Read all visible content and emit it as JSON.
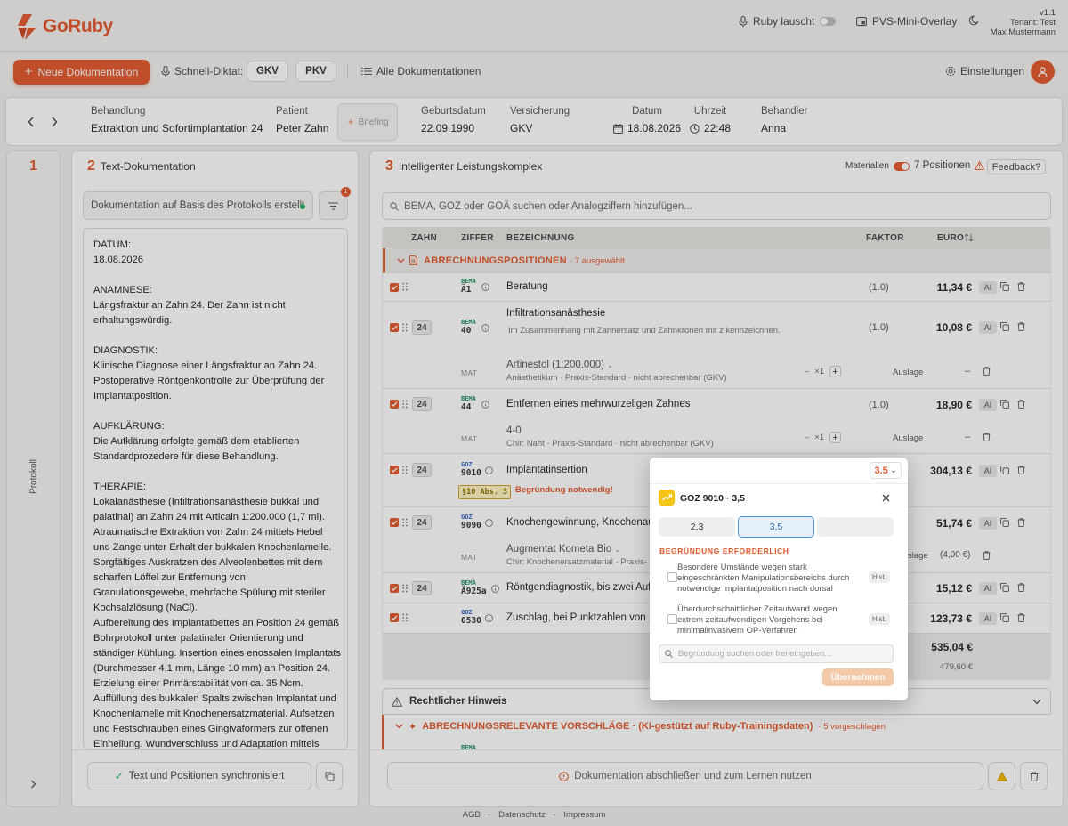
{
  "header": {
    "logo_text": "GoRuby",
    "listening_label": "Ruby lauscht",
    "overlay_label": "PVS-Mini-Overlay",
    "version": "v1.1",
    "tenant": "Tenant: Test",
    "user_name": "Max Mustermann"
  },
  "toolbar": {
    "new_doc_label": "Neue Dokumentation",
    "quick_dictation_label": "Schnell-Diktat:",
    "gkv_label": "GKV",
    "pkv_label": "PKV",
    "all_docs_label": "Alle Dokumentationen",
    "settings_label": "Einstellungen"
  },
  "patient_bar": {
    "treatment_label": "Behandlung",
    "treatment_value": "Extraktion und Sofortimplantation 24",
    "patient_label": "Patient",
    "patient_value": "Peter Zahn",
    "briefing_label": "Briefing",
    "dob_label": "Geburtsdatum",
    "dob_value": "22.09.1990",
    "insurance_label": "Versicherung",
    "insurance_value": "GKV",
    "date_label": "Datum",
    "date_value": "18.08.2026",
    "time_label": "Uhrzeit",
    "time_value": "22:48",
    "practitioner_label": "Behandler",
    "practitioner_value": "Anna"
  },
  "panel1": {
    "number": "1",
    "side_label": "Protokoll"
  },
  "panel2": {
    "number": "2",
    "title": "Text-Dokumentation",
    "template_select": "Dokumentation auf Basis des Protokolls erstellt",
    "filter_badge": "1",
    "lines": [
      "DATUM:",
      "18.08.2026",
      "",
      "ANAMNESE:",
      "Längsfraktur an Zahn 24. Der Zahn ist nicht",
      "erhaltungswürdig.",
      "",
      "DIAGNOSTIK:",
      "Klinische Diagnose einer Längsfraktur an Zahn 24.",
      "Postoperative Röntgenkontrolle zur Überprüfung der",
      "Implantatposition.",
      "",
      "AUFKLÄRUNG:",
      "Die Aufklärung erfolgte gemäß dem etablierten",
      "Standardprozedere für diese Behandlung.",
      "",
      "THERAPIE:",
      "Lokalanästhesie (Infiltrationsanästhesie bukkal und",
      "palatinal) an Zahn 24 mit Articain 1:200.000 (1,7 ml).",
      "Atraumatische Extraktion von Zahn 24 mittels Hebel",
      "und Zange unter Erhalt der bukkalen Knochenlamelle.",
      "Sorgfältiges Auskratzen des Alveolenbettes mit dem",
      "scharfen Löffel zur Entfernung von",
      "Granulationsgewebe, mehrfache Spülung mit steriler",
      "Kochsalzlösung (NaCl).",
      "Aufbereitung des Implantatbettes an Position 24 gemäß",
      "Bohrprotokoll unter palatinaler Orientierung und",
      "ständiger Kühlung. Insertion eines enossalen Implantats",
      "(Durchmesser 4,1 mm, Länge 10 mm) an Position 24.",
      "Erzielung einer Primärstabilität von ca. 35 Ncm.",
      "Auffüllung des bukkalen Spalts zwischen Implantat und",
      "Knochenlamelle mit Knochenersatzmaterial. Aufsetzen",
      "und Festschrauben eines Gingivaformers zur offenen",
      "Einheilung. Wundverschluss und Adaptation mittels"
    ],
    "sync_label": "Text und Positionen synchronisiert"
  },
  "panel3": {
    "number": "3",
    "title": "Intelligenter Leistungskomplex",
    "materials_label": "Materialien",
    "positions_count": "7 Positionen",
    "feedback_label": "Feedback?",
    "search_placeholder": "BEMA, GOZ oder GOÄ suchen oder Analogziffern hinzufügen...",
    "columns": {
      "tooth": "ZAHN",
      "code": "ZIFFER",
      "desc": "BEZEICHNUNG",
      "factor": "FAKTOR",
      "euro": "EURO"
    },
    "group_title": "ABRECHNUNGSPOSITIONEN",
    "group_count": "· 7 ausgewählt",
    "ai_label": "AI",
    "rows": [
      {
        "tooth": "",
        "sys": "BEMA",
        "code": "Ä1",
        "desc": "Beratung",
        "sub": "",
        "factor": "(1.0)",
        "euro": "11,34 €"
      },
      {
        "tooth": "24",
        "sys": "BEMA",
        "code": "40",
        "desc": "Infiltrationsanästhesie",
        "sub": "Im Zusammenhang mit Zahnersatz und Zahnkronen mit z kennzeichnen.",
        "factor": "(1.0)",
        "euro": "10,08 €"
      },
      {
        "tooth": "24",
        "sys": "BEMA",
        "code": "44",
        "desc": "Entfernen eines mehrwurzeligen Zahnes",
        "sub": "",
        "factor": "(1.0)",
        "euro": "18,90 €"
      },
      {
        "tooth": "24",
        "sys": "GOZ",
        "code": "9010",
        "desc": "Implantatinsertion",
        "sub": "",
        "factor": "",
        "euro": "304,13 €"
      },
      {
        "tooth": "24",
        "sys": "GOZ",
        "code": "9090",
        "desc": "Knochengewinnung, Knochenau",
        "sub": "",
        "factor": "",
        "euro": "51,74 €"
      },
      {
        "tooth": "24",
        "sys": "BEMA",
        "code": "Ä925a",
        "desc": "Röntgendiagnostik, bis zwei Auf",
        "sub": "",
        "factor": "",
        "euro": "15,12 €"
      },
      {
        "tooth": "",
        "sys": "GOZ",
        "code": "0530",
        "desc": "Zuschlag, bei Punktzahlen von 1",
        "sub": "",
        "factor": "",
        "euro": "123,73 €"
      }
    ],
    "materials": [
      {
        "tag": "MAT",
        "name": "Artinestol (1:200.000)",
        "sub": "Anästhetikum · Praxis-Standard · nicht abrechenbar (GKV)",
        "qty": "×1",
        "billing": "Auslage",
        "amount": "–"
      },
      {
        "tag": "MAT",
        "name": "4-0",
        "sub": "Chir: Naht · Praxis-Standard · nicht abrechenbar (GKV)",
        "qty": "×1",
        "billing": "Auslage",
        "amount": "–"
      },
      {
        "tag": "MAT",
        "name": "Augmentat Kometa Bio",
        "sub": "Chir: Knochenersatzmaterial · Praxis-",
        "qty": "",
        "billing": "slage",
        "amount": "(4,00 €)"
      }
    ],
    "paragraph_badge": "§10 Abs. 3",
    "reason_required": "Begründung notwendig!",
    "total": "535,04 €",
    "subtotal": "479,60 €",
    "legal_title": "Rechtlicher Hinweis",
    "suggestions_title": "ABRECHNUNGSRELEVANTE VORSCHLÄGE · (KI-gestützt auf Ruby-Trainingsdaten)",
    "suggestions_count": "· 5 vorgeschlagen",
    "finish_label": "Dokumentation abschließen und zum Lernen nutzen"
  },
  "popover": {
    "factor_select": "3.5",
    "title": "GOZ 9010 · 3,5",
    "factors": [
      "2,3",
      "3,5",
      ""
    ],
    "section_label": "BEGRÜNDUNG ERFORDERLICH",
    "reasons": [
      {
        "text": "Besondere Umstände wegen stark eingeschränkten Manipulationsbereichs durch notwendige Implantatposition nach dorsal",
        "tag": "Hist."
      },
      {
        "text": "Überdurchschnittlicher Zeitaufwand wegen extrem zeitaufwendigen Vorgehens bei minimalinvasivem OP-Verfahren",
        "tag": "Hist."
      }
    ],
    "search_placeholder": "Begründung suchen oder frei eingeben...",
    "apply_label": "Übernehmen"
  },
  "footer": {
    "agb": "AGB",
    "privacy": "Datenschutz",
    "imprint": "Impressum"
  },
  "colors": {
    "accent": "#e2572b",
    "bema": "#1a8f5a",
    "goz": "#3566c5",
    "selected_factor": "#e6f0fb"
  }
}
